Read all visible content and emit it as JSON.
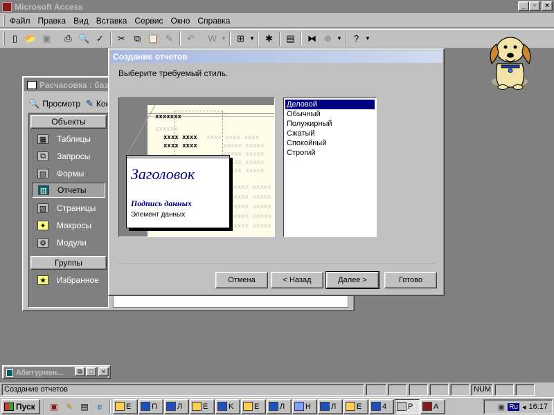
{
  "app": {
    "title": "Microsoft Access",
    "window_buttons": [
      "_",
      "▫",
      "×"
    ]
  },
  "menu": [
    "Файл",
    "Правка",
    "Вид",
    "Вставка",
    "Сервис",
    "Окно",
    "Справка"
  ],
  "toolbar_icons": [
    "new-icon",
    "open-icon",
    "save-icon",
    "print-icon",
    "preview-icon",
    "spelling-icon",
    "cut-icon",
    "copy-icon",
    "paste-icon",
    "format-painter-icon",
    "undo-icon",
    "office-links-icon",
    "analyze-icon",
    "code-icon",
    "properties-icon",
    "relationships-icon",
    "new-object-icon",
    "help-icon"
  ],
  "db_window": {
    "title": "Расчасовка : база",
    "toolbar": {
      "preview": "Просмотр",
      "design": "Кон"
    },
    "objects_header": "Объекты",
    "objects": [
      {
        "label": "Таблицы",
        "icon": "table-icon"
      },
      {
        "label": "Запросы",
        "icon": "query-icon"
      },
      {
        "label": "Формы",
        "icon": "form-icon"
      },
      {
        "label": "Отчеты",
        "icon": "report-icon",
        "selected": true
      },
      {
        "label": "Страницы",
        "icon": "page-icon"
      },
      {
        "label": "Макросы",
        "icon": "macro-icon"
      },
      {
        "label": "Модули",
        "icon": "module-icon"
      }
    ],
    "groups_header": "Группы",
    "groups": [
      {
        "label": "Избранное",
        "icon": "favorites-icon"
      }
    ]
  },
  "wizard": {
    "title": "Создание отчетов",
    "prompt": "Выберите требуемый стиль.",
    "preview": {
      "heading": "Заголовок",
      "caption": "Подпись данных",
      "element": "Элемент данных",
      "bold_placeholder": "xxxxxxx",
      "faint_placeholder": "xxxxxx",
      "field_placeholder": "xxxx xxxx",
      "row_placeholder": "xxxx xxxx xxxx",
      "col_placeholder": "xxxxx xxxxx"
    },
    "styles": [
      "Деловой",
      "Обычный",
      "Полужирный",
      "Сжатый",
      "Спокойный",
      "Строгий"
    ],
    "selected_style": "Деловой",
    "buttons": {
      "cancel": "Отмена",
      "back": "< Назад",
      "next": "Далее >",
      "finish": "Готово"
    }
  },
  "minimized_window": {
    "title": "Абитуриен...",
    "buttons": [
      "⧉",
      "□",
      "×"
    ]
  },
  "status": {
    "text": "Создание отчетов",
    "num": "NUM"
  },
  "taskbar": {
    "start": "Пуск",
    "tasks": [
      {
        "label": "E",
        "icon": "folder-icon"
      },
      {
        "label": "П",
        "icon": "word-icon"
      },
      {
        "label": "Л",
        "icon": "word-icon"
      },
      {
        "label": "E",
        "icon": "folder-icon"
      },
      {
        "label": "K",
        "icon": "word-icon"
      },
      {
        "label": "E",
        "icon": "folder-icon"
      },
      {
        "label": "Л",
        "icon": "word-icon"
      },
      {
        "label": "H",
        "icon": "explorer-icon"
      },
      {
        "label": "Л",
        "icon": "word-icon"
      },
      {
        "label": "E",
        "icon": "folder-icon"
      },
      {
        "label": "4",
        "icon": "word-icon"
      },
      {
        "label": "P",
        "icon": "window-icon",
        "active": true
      },
      {
        "label": "A",
        "icon": "access-icon"
      }
    ],
    "tray": {
      "lang": "Ru",
      "clock": "16:17"
    }
  }
}
